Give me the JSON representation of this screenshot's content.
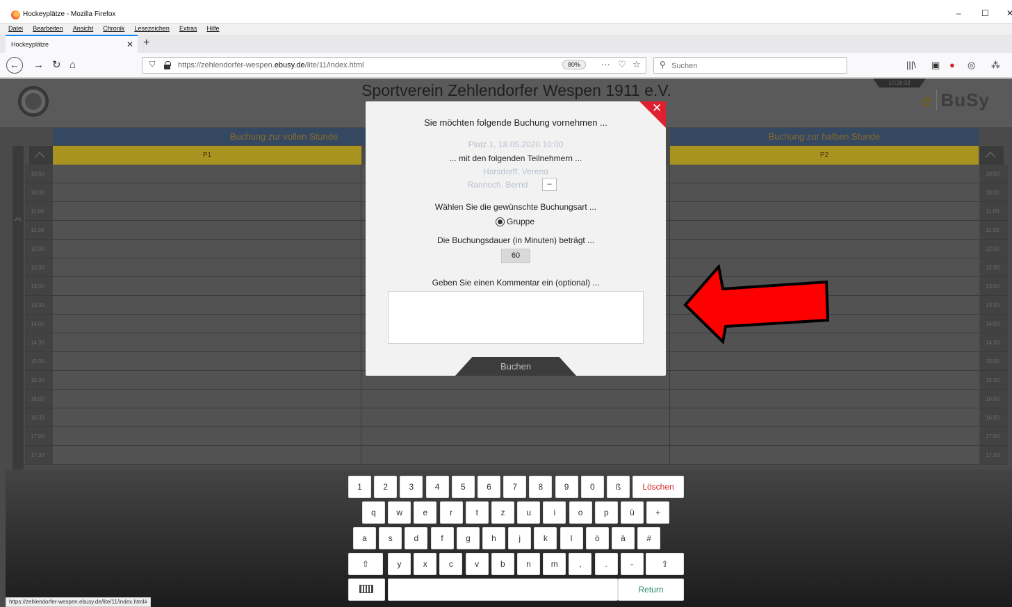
{
  "browser": {
    "window_title": "Hockeyplätze - Mozilla Firefox",
    "menu": [
      "Datei",
      "Bearbeiten",
      "Ansicht",
      "Chronik",
      "Lesezeichen",
      "Extras",
      "Hilfe"
    ],
    "tab_title": "Hockeyplätze",
    "url_prefix": "https://zehlendorfer-wespen.",
    "url_domain": "ebusy.de",
    "url_path": "/lite/11/index.html",
    "zoom": "80%",
    "search_placeholder": "Suchen",
    "status_url": "https://zehlendorfer-wespen.ebusy.de/lite/11/index.html#"
  },
  "page": {
    "club_name": "Sportverein Zehlendorfer Wespen 1911 e.V.",
    "clock": "10:28:33",
    "logo_e": "e",
    "logo_busy": "BuSy",
    "header_left": "Buchung zur vollen Stunde",
    "header_right": "Buchung zur halben Stunde",
    "court_left": "P1",
    "court_right": "P2",
    "times": [
      "10:00",
      "10:30",
      "11:00",
      "11:30",
      "12:00",
      "12:30",
      "13:00",
      "13:30",
      "14:00",
      "14:30",
      "15:00",
      "15:30",
      "16:00",
      "16:30",
      "17:00",
      "17:30"
    ]
  },
  "modal": {
    "title": "Sie möchten folgende Buchung vornehmen ...",
    "booking_info": "Platz 1, 18.05.2020 10:00",
    "participants_label": "... mit den folgenden Teilnehmern ...",
    "participant_1": "Harsdorff, Verena",
    "participant_2": "Rannoch, Bernd",
    "remove_label": "–",
    "type_label": "Wählen Sie die gewünschte Buchungsart ...",
    "type_option": "Gruppe",
    "duration_label": "Die Buchungsdauer (in Minuten) beträgt ...",
    "duration_value": "60",
    "comment_label": "Geben Sie einen Kommentar ein (optional) ...",
    "comment_value": "",
    "book_button": "Buchen",
    "close_symbol": "✕"
  },
  "keyboard": {
    "row1": [
      "1",
      "2",
      "3",
      "4",
      "5",
      "6",
      "7",
      "8",
      "9",
      "0",
      "ß"
    ],
    "delete": "Löschen",
    "row2": [
      "q",
      "w",
      "e",
      "r",
      "t",
      "z",
      "u",
      "i",
      "o",
      "p",
      "ü",
      "+"
    ],
    "row3": [
      "a",
      "s",
      "d",
      "f",
      "g",
      "h",
      "j",
      "k",
      "l",
      "ö",
      "ä",
      "#"
    ],
    "row4": [
      "y",
      "x",
      "c",
      "v",
      "b",
      "n",
      "m",
      ",",
      ".",
      "-"
    ],
    "shift": "⇧",
    "return": "Return",
    "kb_icon": "keyboard-icon"
  },
  "colors": {
    "accent_red": "#e02030",
    "delete_text": "#d92020",
    "header_blue": "#354861",
    "court_gold": "#a89320"
  }
}
